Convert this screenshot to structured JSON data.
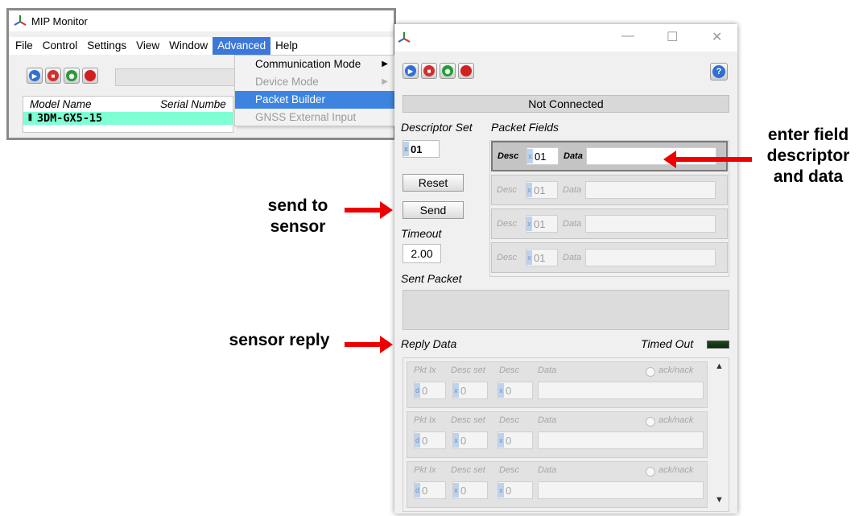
{
  "main_window": {
    "title": "MIP Monitor",
    "menu": [
      "File",
      "Control",
      "Settings",
      "View",
      "Window",
      "Advanced",
      "Help"
    ],
    "device_list": {
      "columns": [
        "Model Name",
        "Serial Numbe"
      ],
      "rows": [
        {
          "model": "3DM-GX5-15"
        }
      ]
    },
    "advanced_menu": {
      "items": [
        {
          "label": "Communication Mode",
          "enabled": true,
          "submenu": true
        },
        {
          "label": "Device Mode",
          "enabled": false,
          "submenu": true
        },
        {
          "label": "Packet Builder",
          "enabled": true,
          "highlighted": true
        },
        {
          "label": "GNSS External Input",
          "enabled": false
        }
      ]
    }
  },
  "packet_builder": {
    "window_controls": {
      "minimize": "—",
      "maximize": "☐",
      "close": "✕"
    },
    "help_label": "?",
    "status": "Not Connected",
    "descriptor_set_label": "Descriptor Set",
    "descriptor_set_value": "01",
    "packet_fields_label": "Packet Fields",
    "reset_label": "Reset",
    "send_label": "Send",
    "timeout_label": "Timeout",
    "timeout_value": "2.00",
    "sent_packet_label": "Sent Packet",
    "reply_data_label": "Reply Data",
    "timed_out_label": "Timed Out",
    "fields": [
      {
        "desc_label": "Desc",
        "desc": "01",
        "data_label": "Data",
        "data": "",
        "active": true
      },
      {
        "desc_label": "Desc",
        "desc": "01",
        "data_label": "Data",
        "data": "",
        "active": false
      },
      {
        "desc_label": "Desc",
        "desc": "01",
        "data_label": "Data",
        "data": "",
        "active": false
      },
      {
        "desc_label": "Desc",
        "desc": "01",
        "data_label": "Data",
        "data": "",
        "active": false
      }
    ],
    "reply_columns": {
      "pkt_ix": "Pkt Ix",
      "desc_set": "Desc set",
      "desc": "Desc",
      "data": "Data",
      "ack": "ack/nack"
    },
    "reply_rows": [
      {
        "pkt_ix": "0",
        "desc_set": "0",
        "desc": "0"
      },
      {
        "pkt_ix": "0",
        "desc_set": "0",
        "desc": "0"
      },
      {
        "pkt_ix": "0",
        "desc_set": "0",
        "desc": "0"
      }
    ]
  },
  "annotations": {
    "send": "send to sensor",
    "reply": "sensor reply",
    "field": "enter field descriptor and data"
  },
  "colors": {
    "arrow": "#e00000",
    "menu_highlight": "#3c78d8",
    "device_row": "#7fffd4",
    "timed_out_led": "#1b4a1b"
  }
}
